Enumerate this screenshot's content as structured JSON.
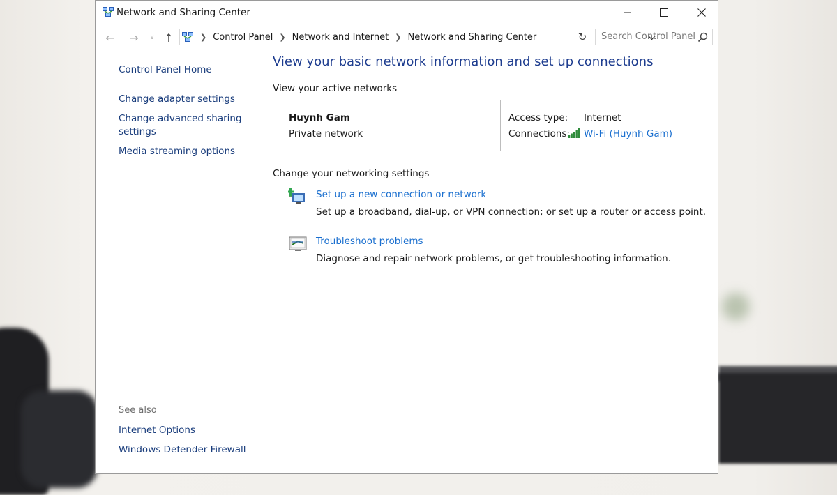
{
  "window": {
    "title": "Network and Sharing Center",
    "controls": {
      "minimize": "minimize-icon",
      "maximize": "maximize-icon",
      "close": "close-icon"
    }
  },
  "address": {
    "crumbs": [
      "Control Panel",
      "Network and Internet",
      "Network and Sharing Center"
    ],
    "search_placeholder": "Search Control Panel"
  },
  "sidebar": {
    "home": "Control Panel Home",
    "links": [
      "Change adapter settings",
      "Change advanced sharing settings",
      "Media streaming options"
    ],
    "see_also_label": "See also",
    "see_also": [
      "Internet Options",
      "Windows Defender Firewall"
    ]
  },
  "main": {
    "title": "View your basic network information and set up connections",
    "active_networks_heading": "View your active networks",
    "network": {
      "name": "Huynh Gam",
      "category": "Private network",
      "access_type_label": "Access type:",
      "access_type_value": "Internet",
      "connections_label": "Connections:",
      "connections_value": "Wi-Fi (Huynh Gam)"
    },
    "change_settings_heading": "Change your networking settings",
    "tasks": [
      {
        "link": "Set up a new connection or network",
        "description": "Set up a broadband, dial-up, or VPN connection; or set up a router or access point."
      },
      {
        "link": "Troubleshoot problems",
        "description": "Diagnose and repair network problems, or get troubleshooting information."
      }
    ]
  },
  "colors": {
    "link": "#1a6fcf",
    "title": "#1e3d8f",
    "sidebar_link": "#1a3d7c",
    "wifi_bars": "#2e8b3a"
  }
}
